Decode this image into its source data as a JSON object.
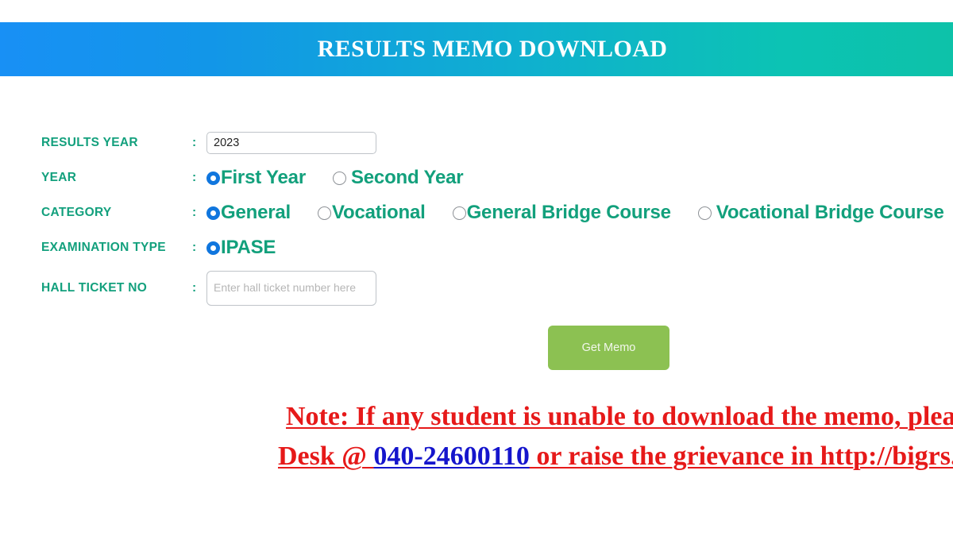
{
  "header": {
    "title": "RESULTS MEMO DOWNLOAD",
    "gradient_start": "#1890f5",
    "gradient_end": "#0dc2a9"
  },
  "form": {
    "label_color": "#13a07d",
    "option_color": "#12a07c",
    "radio_selected_color": "#1076de",
    "rows": {
      "results_year": {
        "label": "RESULTS YEAR",
        "colon": ":",
        "value": "2023",
        "placeholder": ""
      },
      "year": {
        "label": "YEAR",
        "colon": ":",
        "options": [
          {
            "label": "First Year",
            "selected": true
          },
          {
            "label": "Second Year",
            "selected": false
          }
        ]
      },
      "category": {
        "label": "CATEGORY",
        "colon": ":",
        "options": [
          {
            "label": "General",
            "selected": true
          },
          {
            "label": "Vocational",
            "selected": false
          },
          {
            "label": "General Bridge Course",
            "selected": false
          },
          {
            "label": "Vocational Bridge Course",
            "selected": false
          }
        ]
      },
      "examination_type": {
        "label": "EXAMINATION TYPE",
        "colon": ":",
        "options": [
          {
            "label": "IPASE",
            "selected": true
          }
        ]
      },
      "hall_ticket_no": {
        "label": "HALL TICKET NO",
        "colon": ":",
        "value": "",
        "placeholder": "Enter hall ticket number here"
      }
    }
  },
  "actions": {
    "get_memo_label": "Get Memo",
    "get_memo_color": "#8cc152"
  },
  "note": {
    "color": "#e61919",
    "link_color": "#1515cc",
    "line1_a": "Note: If any student is unable to download the memo, please con",
    "line2_a": "Desk @ ",
    "line2_phone": "040-24600110",
    "line2_b": " or raise the grievance in http://bigrs.tel"
  }
}
